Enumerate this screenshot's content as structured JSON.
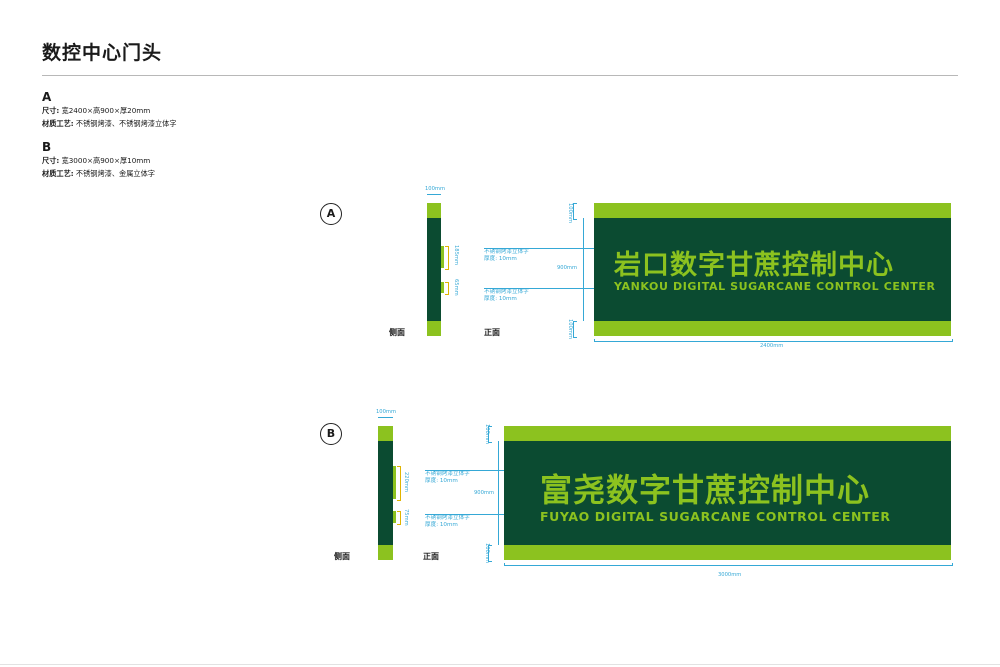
{
  "page": {
    "title": "数控中心门头"
  },
  "specs": {
    "a": {
      "letter": "A",
      "size_label": "尺寸:",
      "size_value": "宽2400×高900×厚20mm",
      "material_label": "材质工艺:",
      "material_value": "不锈钢烤漆、不锈钢烤漆立体字"
    },
    "b": {
      "letter": "B",
      "size_label": "尺寸:",
      "size_value": "宽3000×高900×厚10mm",
      "material_label": "材质工艺:",
      "material_value": "不锈钢烤漆、金属立体字"
    }
  },
  "drawing_a": {
    "marker": "A",
    "side_label": "侧面",
    "front_label": "正面",
    "side_width": "100mm",
    "side_dim_1": "185mm",
    "side_dim_2": "65mm",
    "callout_1_line1": "不锈钢烤漆立体字",
    "callout_1_line2": "厚度: 10mm",
    "callout_2_line1": "不锈钢烤漆立体字",
    "callout_2_line2": "厚度: 10mm",
    "height_total": "900mm",
    "band_top": "100mm",
    "band_bottom": "100mm",
    "width_total": "2400mm",
    "sign_cn": "岩口数字甘蔗控制中心",
    "sign_en": "YANKOU DIGITAL SUGARCANE CONTROL CENTER"
  },
  "drawing_b": {
    "marker": "B",
    "side_label": "侧面",
    "front_label": "正面",
    "side_width": "100mm",
    "side_dim_1": "220mm",
    "side_dim_2": "75mm",
    "callout_1_line1": "不锈钢烤漆立体字",
    "callout_1_line2": "厚度: 10mm",
    "callout_2_line1": "不锈钢烤漆立体字",
    "callout_2_line2": "厚度: 10mm",
    "height_total": "900mm",
    "band_top": "100mm",
    "band_bottom": "100mm",
    "width_total": "3000mm",
    "sign_cn": "富尧数字甘蔗控制中心",
    "sign_en": "FUYAO DIGITAL SUGARCANE CONTROL CENTER"
  },
  "colors": {
    "sign_dark": "#0b4b31",
    "sign_lime": "#8cc21f",
    "dimension_blue": "#35a8d6"
  }
}
